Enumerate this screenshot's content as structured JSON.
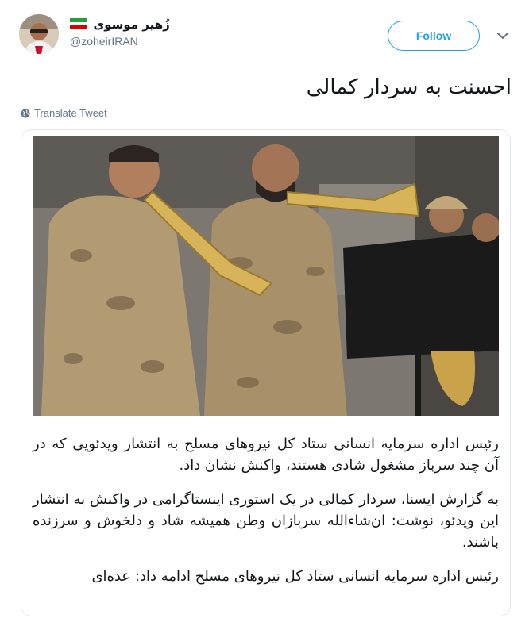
{
  "user": {
    "display_name": "زُهیر موسوی",
    "handle": "@zoheirIRAN",
    "flag_icon": "iran-flag-icon"
  },
  "actions": {
    "follow_label": "Follow",
    "menu_icon": "chevron-down-icon"
  },
  "tweet": {
    "text": "احسنت به سردار کمالی",
    "translate_label": "Translate Tweet",
    "translate_icon": "globe-icon"
  },
  "card": {
    "paragraphs": [
      "رئیس اداره سرمایه انسانی ستاد کل نیروهای مسلح به انتشار ویدئویی که در آن چند سرباز مشغول شادی هستند، واکنش نشان داد.",
      "به گزارش ایسنا، سردار کمالی در یک استوری اینستاگرامی در واکنش به انتشار این ویدئو، نوشت: ان‌شاءالله سربازان وطن همیشه شاد و دلخوش و سرزنده باشند.",
      "رئیس اداره سرمایه انسانی ستاد کل نیروهای مسلح ادامه داد: عده‌ای"
    ]
  },
  "colors": {
    "accent": "#1da1f2",
    "text": "#14171a",
    "muted": "#657786",
    "border": "#e1e8ed"
  }
}
